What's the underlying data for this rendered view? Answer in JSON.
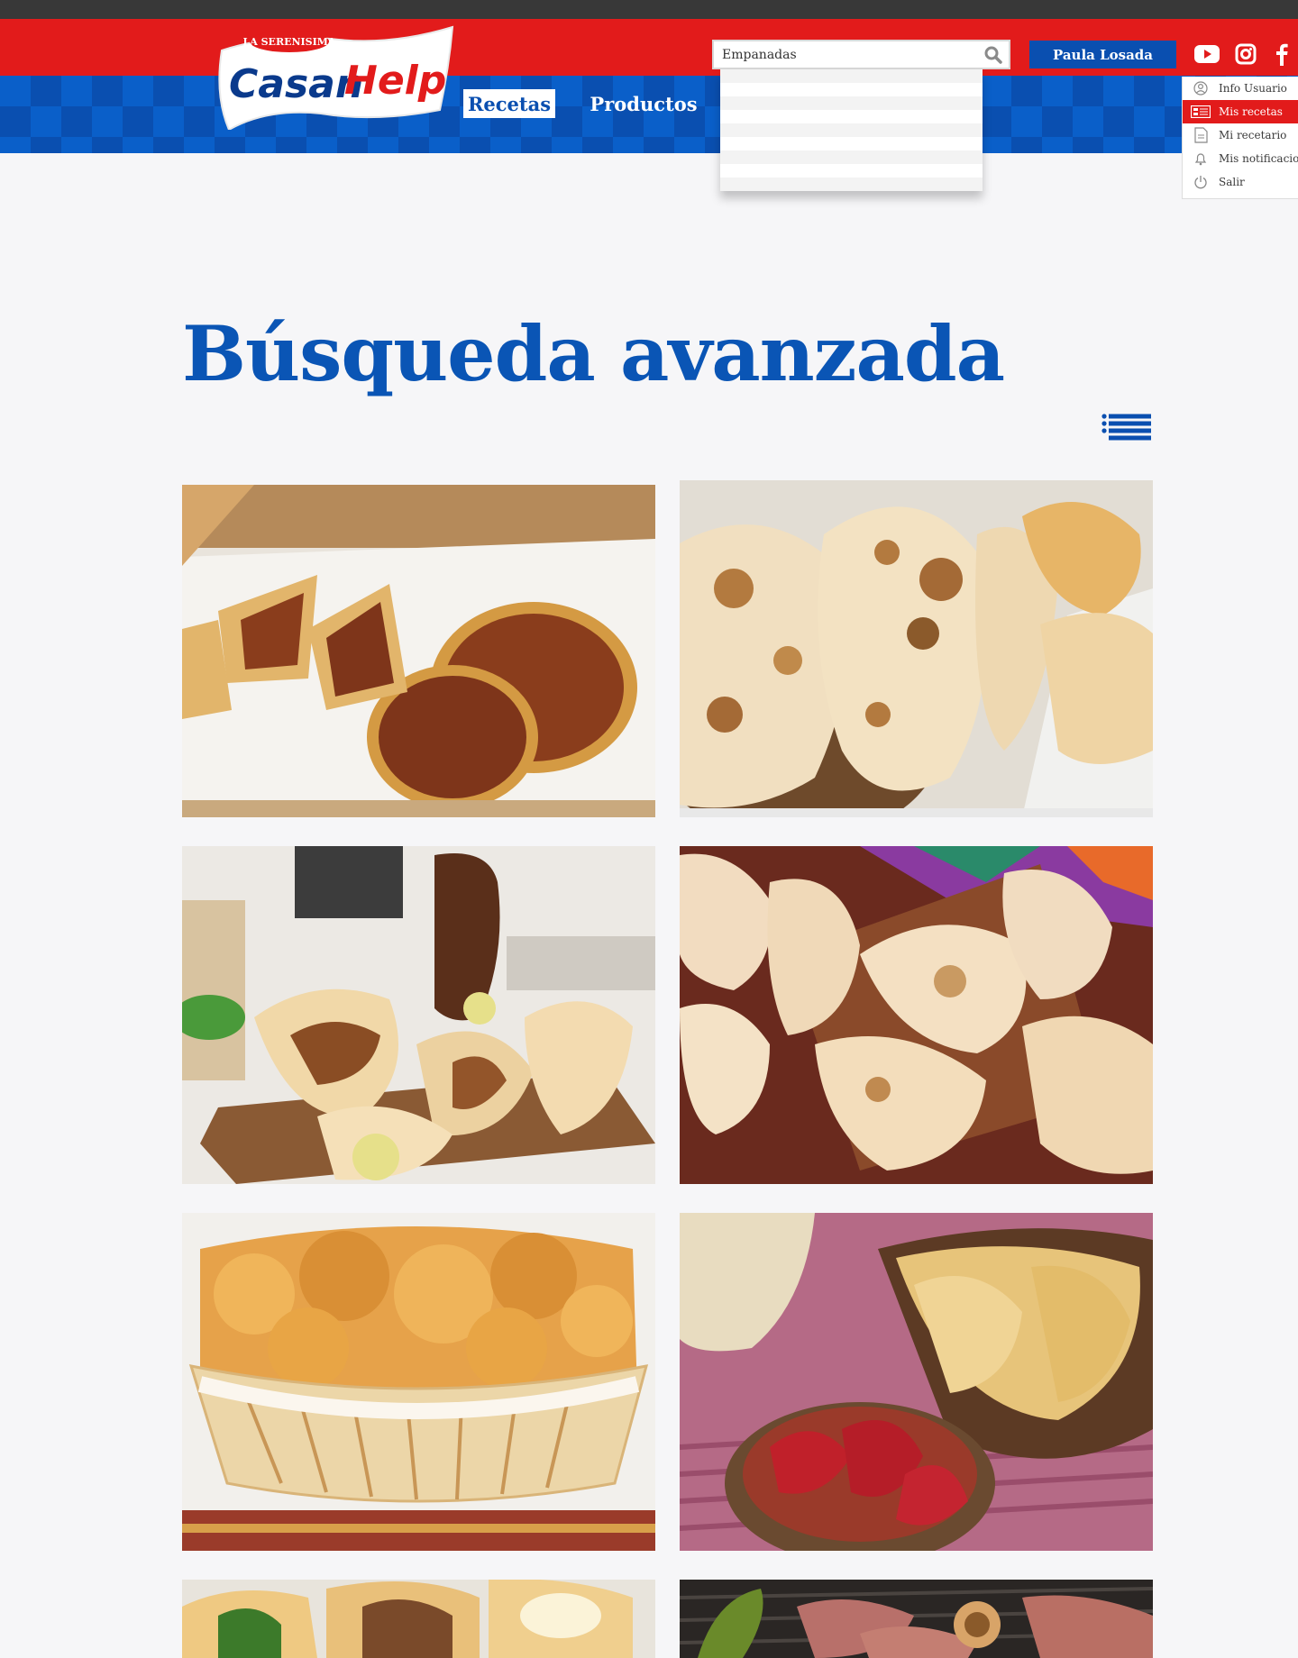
{
  "header": {
    "logo": {
      "brand_small": "LA SERENISIMA",
      "brand_part1": "Casan",
      "brand_part2": "Help"
    },
    "nav": [
      {
        "label": "Recetas",
        "active": true
      },
      {
        "label": "Productos",
        "active": false
      }
    ],
    "search": {
      "value": "Empanadas",
      "icon": "search-icon"
    },
    "user": {
      "name": "Paula Losada"
    },
    "social": [
      "youtube-icon",
      "instagram-icon",
      "facebook-icon"
    ],
    "user_menu": [
      {
        "label": "Info Usuario",
        "icon": "user-icon",
        "active": false
      },
      {
        "label": "Mis recetas",
        "icon": "recipes-icon",
        "active": true
      },
      {
        "label": "Mi recetario",
        "icon": "recipe-book-icon",
        "active": false
      },
      {
        "label": "Mis notificaciones",
        "icon": "bell-icon",
        "active": false
      },
      {
        "label": "Salir",
        "icon": "power-icon",
        "active": false
      }
    ]
  },
  "main": {
    "title": "Búsqueda avanzada",
    "view_toggle_icon": "list-view-icon"
  },
  "colors": {
    "brand_red": "#e21b1b",
    "brand_blue": "#0a4fb0",
    "title_blue": "#0a55b5",
    "topbar": "#383838",
    "page_bg": "#f6f6f8"
  }
}
